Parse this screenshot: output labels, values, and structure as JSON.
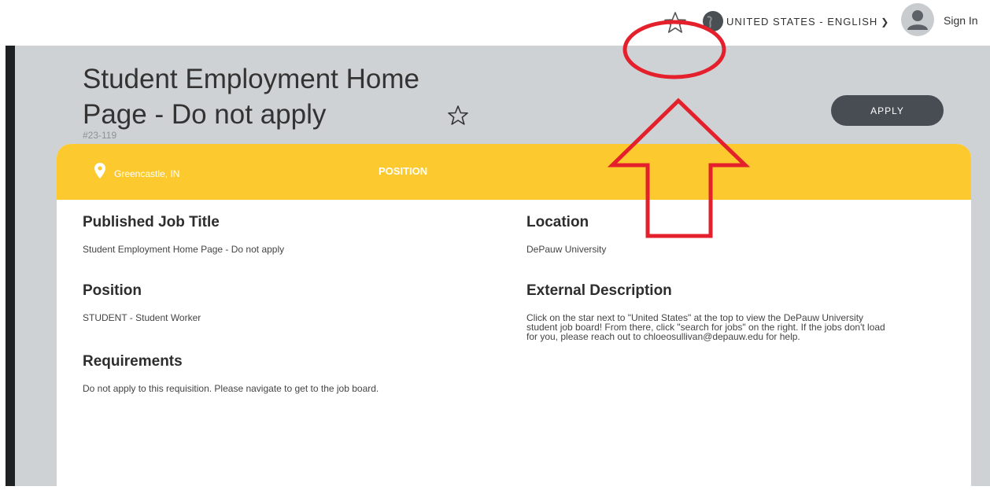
{
  "header": {
    "language_label": "UNITED STATES - ENGLISH",
    "sign_in_label": "Sign In"
  },
  "job": {
    "title": "Student Employment Home Page - Do not apply",
    "req_id": "#23-119",
    "apply_label": "APPLY"
  },
  "card": {
    "location_short": "Greencastle, IN",
    "tab_label": "POSITION",
    "fields": {
      "published_title": {
        "label": "Published Job Title",
        "value": "Student Employment Home Page - Do not apply"
      },
      "position": {
        "label": "Position",
        "value": "STUDENT - Student Worker"
      },
      "requirements": {
        "label": "Requirements",
        "value": "Do not apply to this requisition. Please navigate to get to the job board."
      },
      "location": {
        "label": "Location",
        "value": "DePauw University"
      },
      "external_description": {
        "label": "External Description",
        "lines": [
          "Click on the star next to \"United States\" at the top to view the DePauw University",
          "student job board! From there, click \"search for jobs\" on the right. If the jobs don't load",
          "for you, please reach out to chloeosullivan@depauw.edu for help."
        ]
      }
    }
  },
  "colors": {
    "accent_yellow": "#fcca2f",
    "apply_button": "#474d52",
    "band_grey": "#cfd2d4",
    "annotation_red": "#e3202b"
  },
  "icons": [
    "star-icon",
    "globe-icon",
    "chevron-down-icon",
    "avatar-icon",
    "map-pin-icon"
  ]
}
